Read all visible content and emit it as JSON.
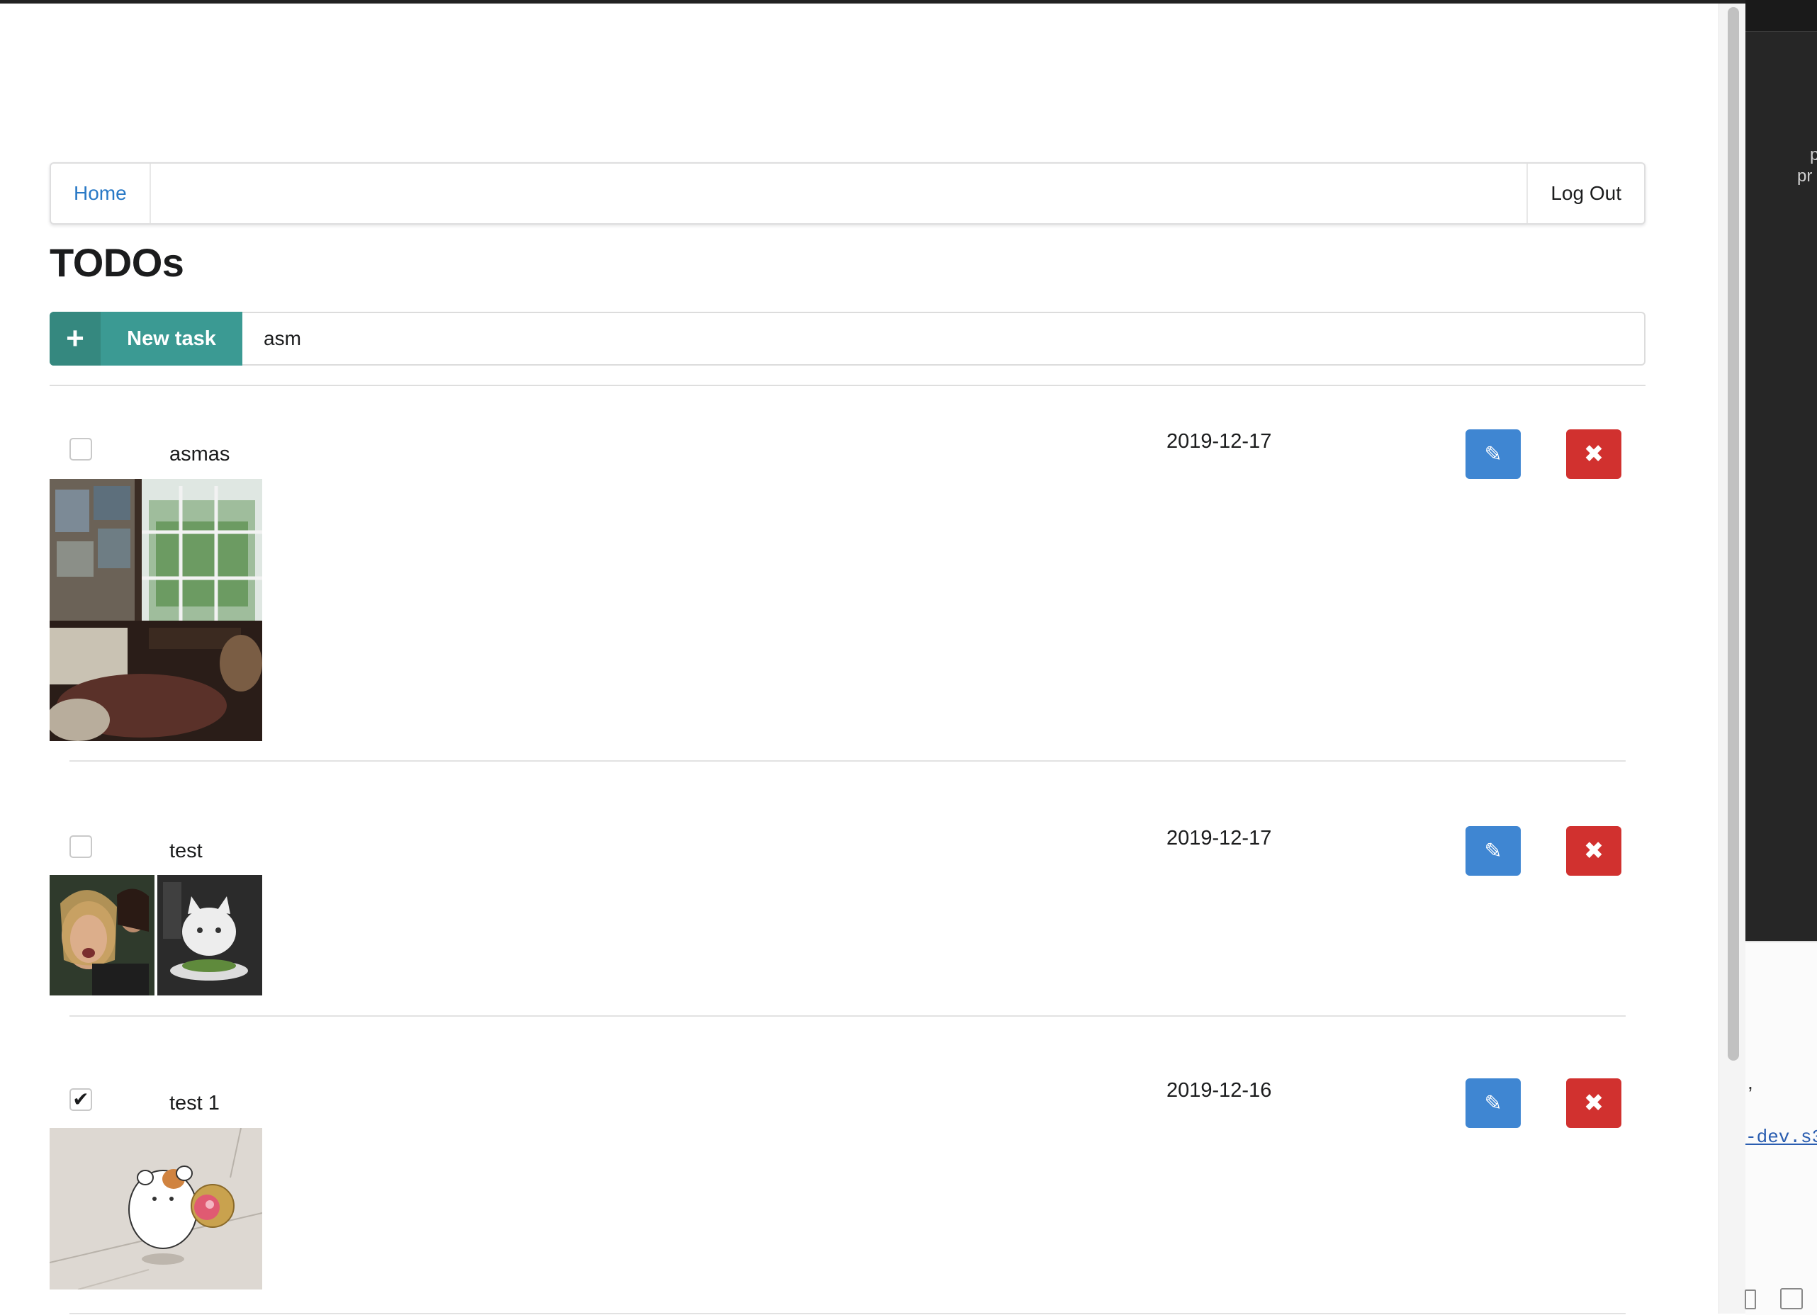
{
  "nav": {
    "home_label": "Home",
    "logout_label": "Log Out"
  },
  "page": {
    "title": "TODOs"
  },
  "new_task": {
    "button_label": "New task",
    "input_value": "asm"
  },
  "todos": [
    {
      "name": "asmas",
      "date": "2019-12-17",
      "done": false
    },
    {
      "name": "test",
      "date": "2019-12-17",
      "done": false
    },
    {
      "name": "test 1",
      "date": "2019-12-16",
      "done": true
    }
  ],
  "background_window": {
    "text_line_1": "p",
    "text_line_2": "pr",
    "link_text": "-dev.s3",
    "comma": ","
  },
  "icons": {
    "add": "plus-icon",
    "edit": "pencil-icon",
    "delete": "close-icon",
    "checked": "checkmark-icon"
  },
  "colors": {
    "new_task": "#3b9a93",
    "edit": "#3f86d2",
    "delete": "#d1312f",
    "link": "#2979c6"
  }
}
